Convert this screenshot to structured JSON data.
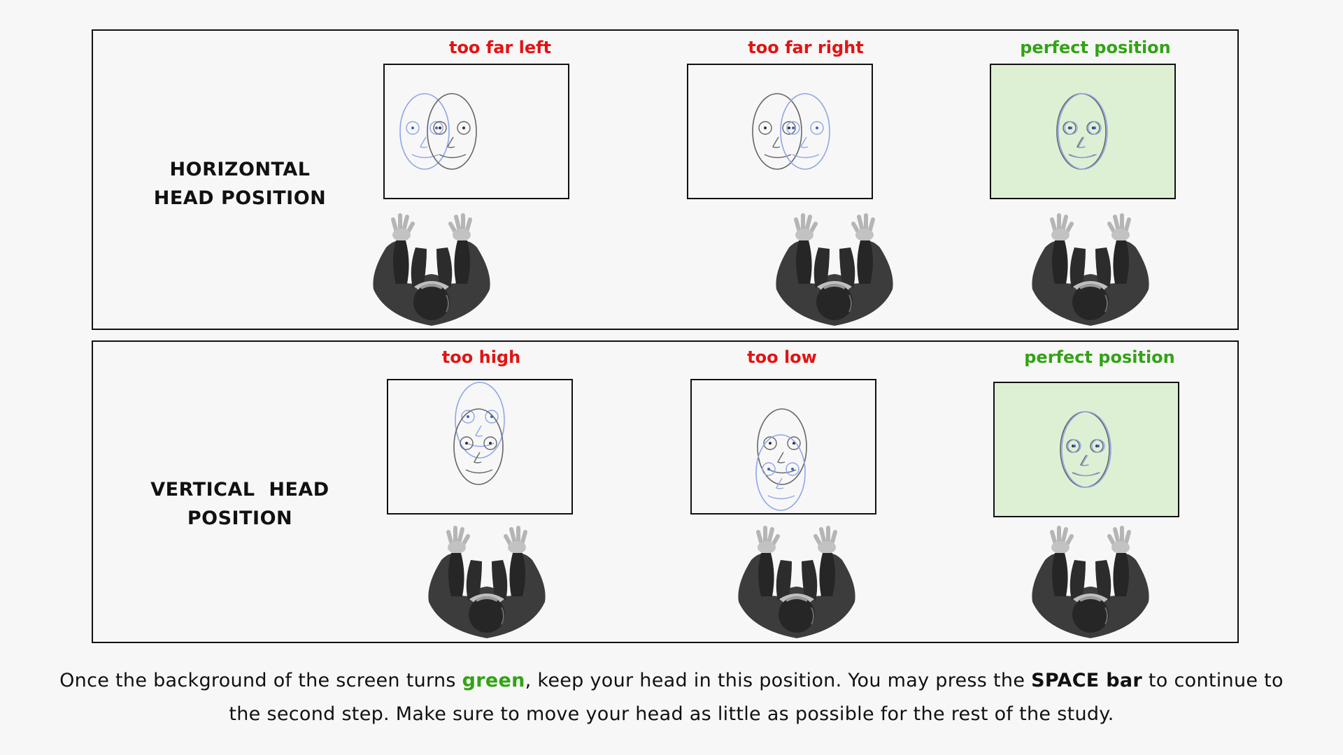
{
  "rows": {
    "horizontal": {
      "title": "HORIZONTAL\nHEAD POSITION",
      "captions": [
        "too far left",
        "too far right",
        "perfect position"
      ]
    },
    "vertical": {
      "title": "VERTICAL  HEAD\nPOSITION",
      "captions": [
        "too high",
        "too low",
        "perfect position"
      ]
    }
  },
  "instructions": {
    "part1": "Once the background of the screen turns ",
    "green_word": "green",
    "part2": ", keep your head in this position.  You may press the ",
    "key": "SPACE bar",
    "part3": " to continue to the second step. Make sure to move your head as little as possible for the rest of the study."
  },
  "colors": {
    "error_caption": "#e31313",
    "success_caption": "#32a315",
    "success_screen": "#def0d3",
    "target_face_outline": "#8fa6e8",
    "user_face_outline": "#555555",
    "person_body": "#404040"
  },
  "icons": [
    "face-outline-icon",
    "target-face-icon",
    "person-top-view-icon"
  ]
}
